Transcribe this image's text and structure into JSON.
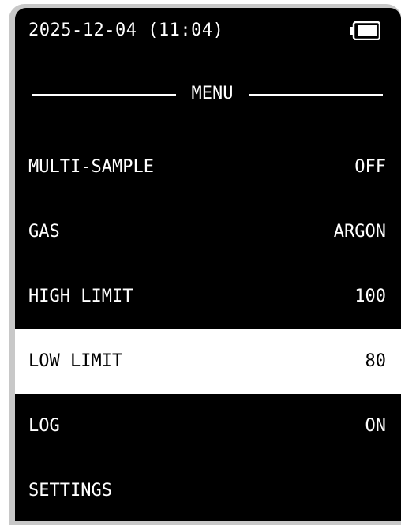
{
  "status": {
    "datetime": "2025-12-04 (11:04)",
    "battery_icon": "battery-icon",
    "battery_level": 0.8
  },
  "menu": {
    "title": "MENU",
    "selected_index": 3,
    "items": [
      {
        "label": "MULTI-SAMPLE",
        "value": "OFF"
      },
      {
        "label": "GAS",
        "value": "ARGON"
      },
      {
        "label": "HIGH LIMIT",
        "value": "100"
      },
      {
        "label": "LOW LIMIT",
        "value": "80"
      },
      {
        "label": "LOG",
        "value": "ON"
      },
      {
        "label": "SETTINGS",
        "value": ""
      }
    ]
  },
  "colors": {
    "screen_bg": "#000000",
    "text": "#ffffff",
    "selected_bg": "#ffffff",
    "selected_text": "#000000",
    "bezel": "#c8c8c8"
  }
}
